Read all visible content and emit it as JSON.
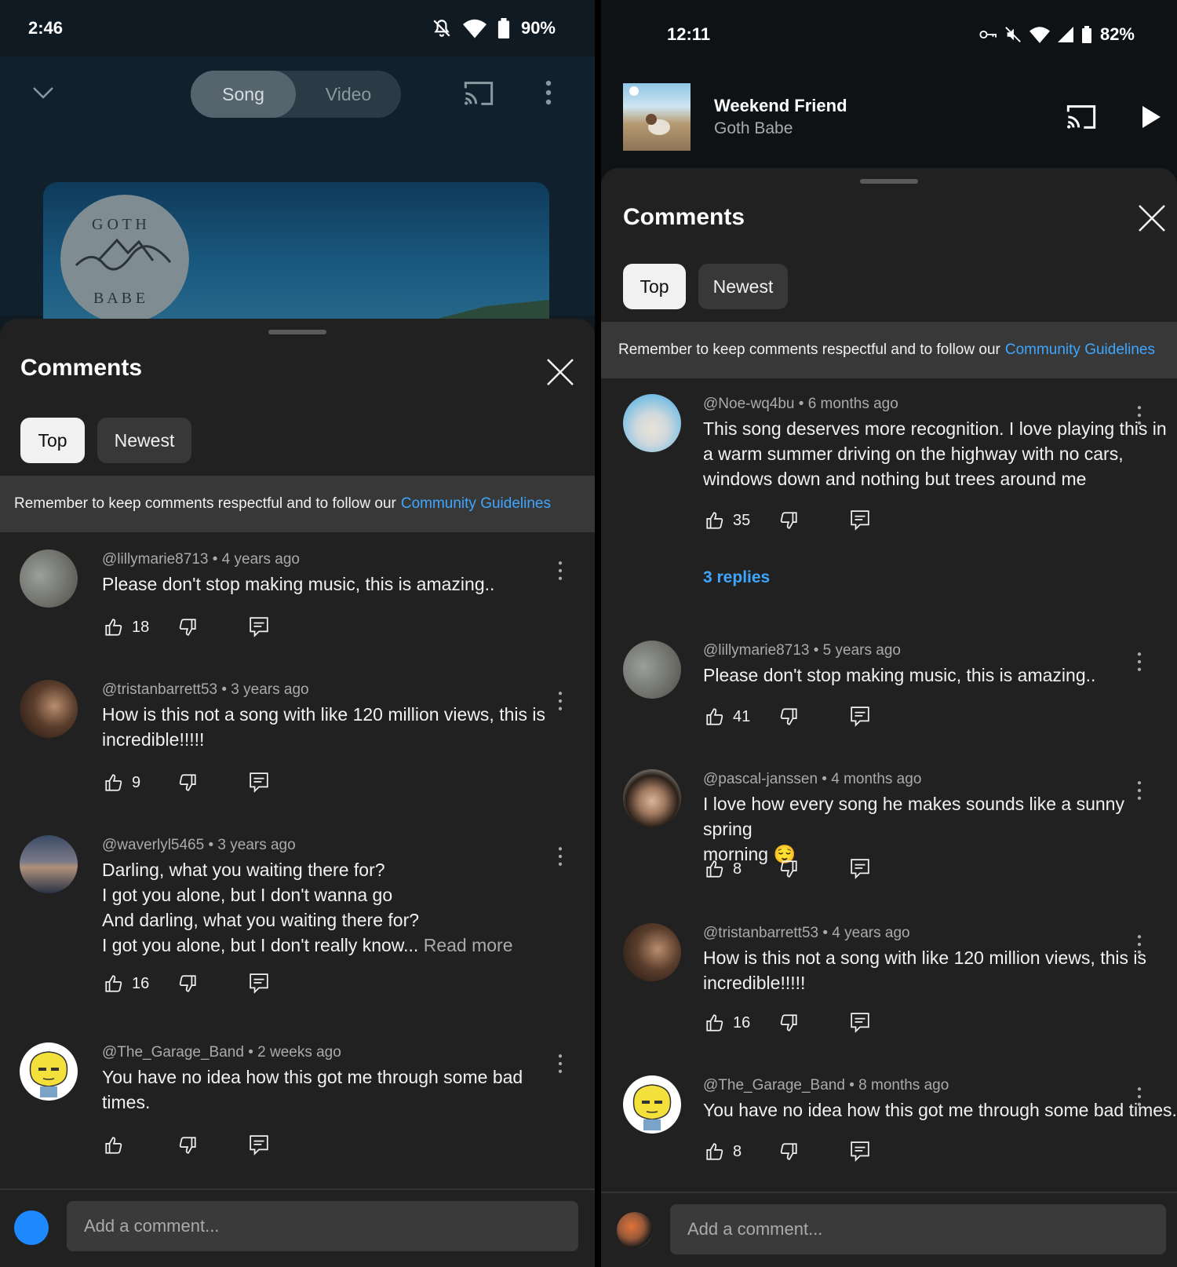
{
  "left": {
    "status": {
      "time": "2:46",
      "battery": "90%"
    },
    "toggle": {
      "song": "Song",
      "video": "Video"
    },
    "sheet": {
      "title": "Comments",
      "tabs": [
        "Top",
        "Newest"
      ],
      "guidelines_text": "Remember to keep comments respectful and to follow our",
      "guidelines_link": "Community Guidelines"
    },
    "comments": [
      {
        "author": "@lillymarie8713",
        "age": "4 years ago",
        "text": "Please don't stop making music, this is amazing..",
        "likes": "18"
      },
      {
        "author": "@tristanbarrett53",
        "age": "3 years ago",
        "text": "How is this not a song with like 120 million views, this is\nincredible!!!!!",
        "likes": "9"
      },
      {
        "author": "@waverlyl5465",
        "age": "3 years ago",
        "text": "Darling, what you waiting there for?\nI got you alone, but I don't wanna go\nAnd darling, what you waiting there for?\nI got you alone, but I don't really know...",
        "read_more": "Read more",
        "likes": "16"
      },
      {
        "author": "@The_Garage_Band",
        "age": "2 weeks ago",
        "text": "You have no idea how this got me through some bad\ntimes.",
        "likes": ""
      }
    ],
    "add_comment_placeholder": "Add a comment..."
  },
  "right": {
    "status": {
      "time": "12:11",
      "battery": "82%"
    },
    "player": {
      "title": "Weekend Friend",
      "artist": "Goth Babe"
    },
    "sheet": {
      "title": "Comments",
      "tabs": [
        "Top",
        "Newest"
      ],
      "guidelines_text": "Remember to keep comments respectful and to follow our",
      "guidelines_link": "Community Guidelines"
    },
    "comments": [
      {
        "author": "@Noe-wq4bu",
        "age": "6 months ago",
        "text": "This song deserves more recognition. I love playing this in\na warm summer driving on the highway with no cars,\nwindows down and nothing but trees around me",
        "likes": "35",
        "replies": "3 replies"
      },
      {
        "author": "@lillymarie8713",
        "age": "5 years ago",
        "text": "Please don't stop making music, this is amazing..",
        "likes": "41"
      },
      {
        "author": "@pascal-janssen",
        "age": "4 months ago",
        "text": "I love how every song he makes sounds like a sunny spring\nmorning 😌",
        "likes": "8"
      },
      {
        "author": "@tristanbarrett53",
        "age": "4 years ago",
        "text": "How is this not a song with like 120 million views, this is\nincredible!!!!!",
        "likes": "16"
      },
      {
        "author": "@The_Garage_Band",
        "age": "8 months ago",
        "text": "You have no idea how this got me through some bad times.",
        "likes": "8"
      }
    ],
    "add_comment_placeholder": "Add a comment..."
  },
  "colors": {
    "accent": "#3ea6ff",
    "sheet_bg": "#212121",
    "chip_active": "#f1f1f1"
  },
  "icons": [
    "bell-off-icon",
    "wifi-icon",
    "battery-icon",
    "chevron-down-icon",
    "cast-icon",
    "more-vert-icon",
    "close-icon",
    "thumb-up-icon",
    "thumb-down-icon",
    "reply-icon",
    "play-icon",
    "vpn-key-icon",
    "mute-icon",
    "signal-icon"
  ]
}
